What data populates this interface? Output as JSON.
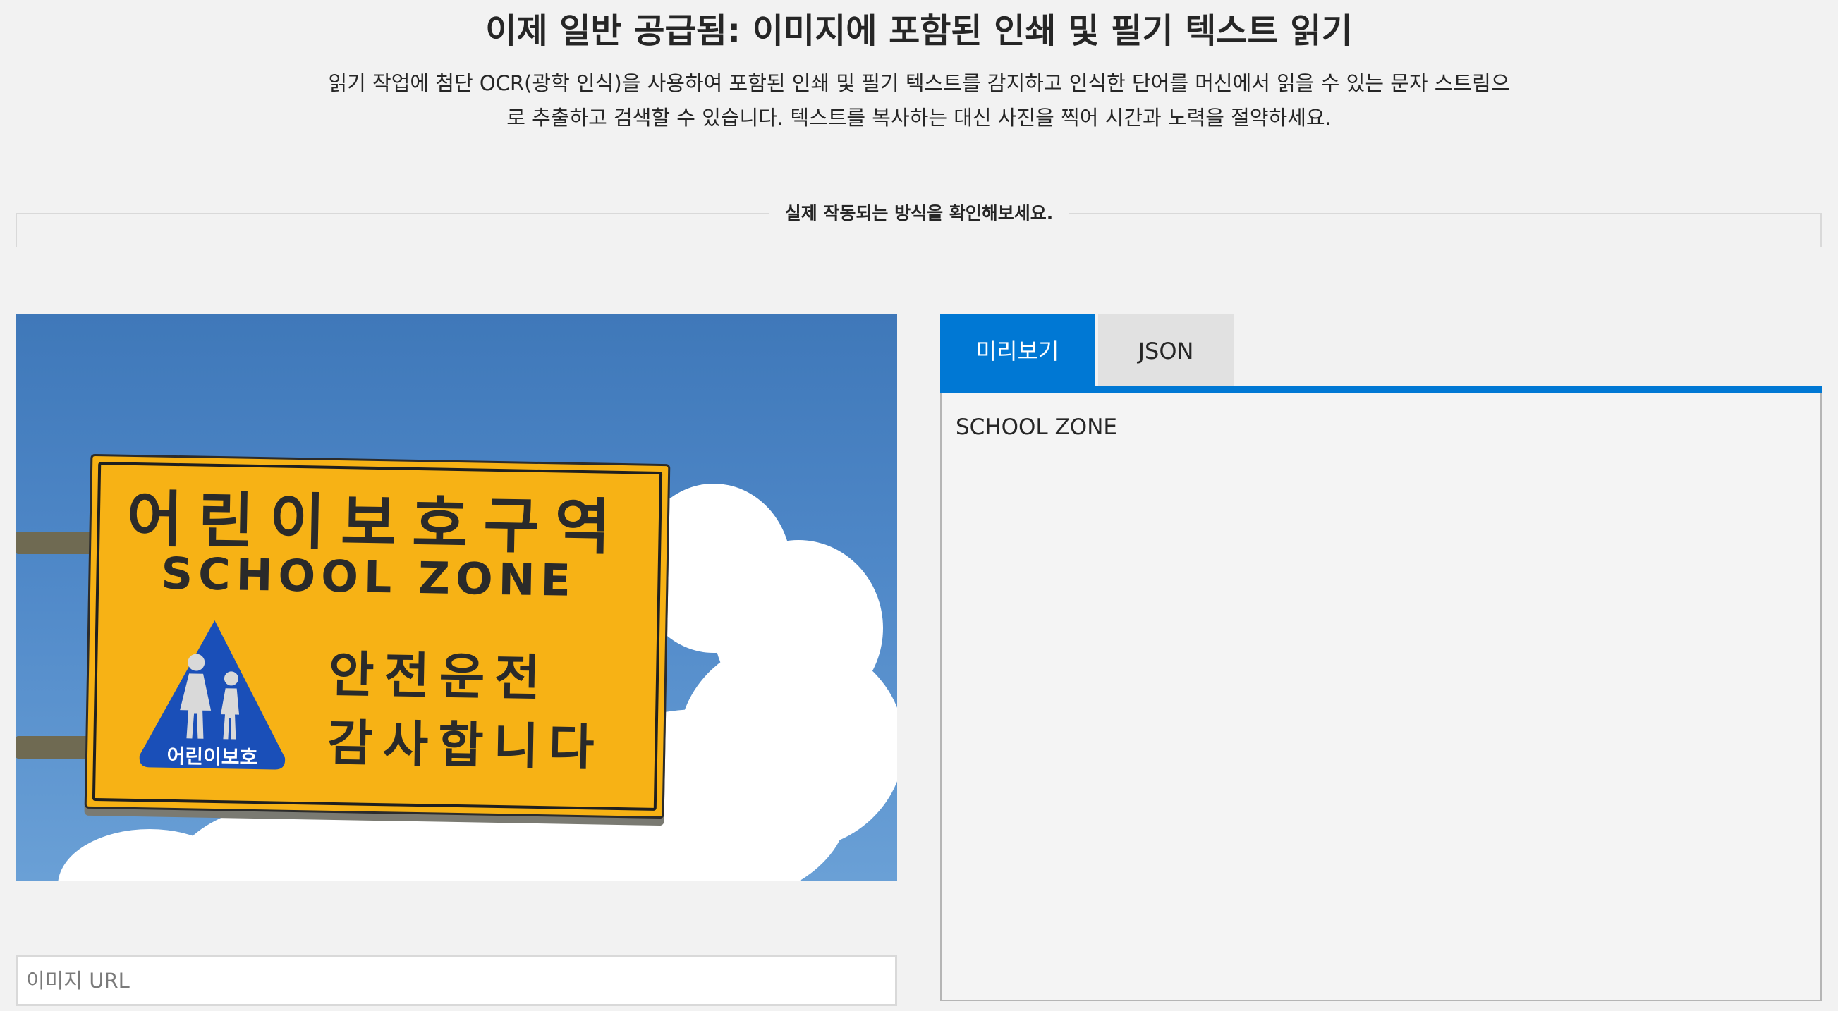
{
  "header": {
    "title": "이제 일반 공급됨: 이미지에 포함된 인쇄 및 필기 텍스트 읽기",
    "description": "읽기 작업에 첨단 OCR(광학 인식)을 사용하여 포함된 인쇄 및 필기 텍스트를 감지하고 인식한 단어를 머신에서 읽을 수 있는 문자 스트림으로 추출하고 검색할 수 있습니다. 텍스트를 복사하는 대신 사진을 찍어 시간과 노력을 절약하세요."
  },
  "demo": {
    "section_label": "실제 작동되는 방식을 확인해보세요.",
    "sample_image": {
      "sign_korean": "어린이보호구역",
      "sign_english": "SCHOOL ZONE",
      "sign_line1": "안전운전",
      "sign_line2": "감사합니다",
      "triangle_label": "어린이보호",
      "colors": {
        "sign": "#f7b215",
        "triangle": "#1a4fb8",
        "sky": "#4f88c8"
      }
    },
    "url_input": {
      "value": "",
      "placeholder": "이미지 URL"
    },
    "tabs": [
      {
        "label": "미리보기",
        "active": true
      },
      {
        "label": "JSON",
        "active": false
      }
    ],
    "result_text": "SCHOOL ZONE",
    "colors": {
      "accent": "#0078d4"
    }
  }
}
